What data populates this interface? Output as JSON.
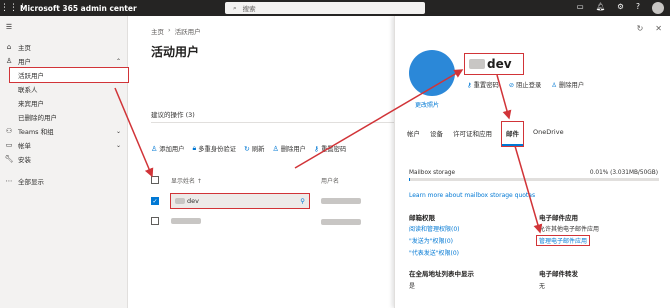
{
  "app": {
    "title": "Microsoft 365 admin center",
    "search_placeholder": "搜索"
  },
  "nav": {
    "home": "主页",
    "users": "用户",
    "active_users": "活跃用户",
    "contacts": "联系人",
    "guest_users": "来宾用户",
    "deleted_users": "已删除的用户",
    "teams_groups": "Teams 和组",
    "billing": "帐单",
    "setup": "安装",
    "show_all": "全部显示"
  },
  "main": {
    "breadcrumb": [
      "主页",
      "活跃用户"
    ],
    "title": "活动用户",
    "suggested": "建议的操作 (3)",
    "toolbar": [
      "添加用户",
      "多重身份验证",
      "刷新",
      "删除用户",
      "重置密码"
    ],
    "columns": [
      "显示姓名 ↑",
      "用户名"
    ],
    "rows": [
      {
        "name": "dev"
      }
    ]
  },
  "panel": {
    "user_name": "dev",
    "change_photo": "更改照片",
    "actions": [
      "重置密码",
      "阻止登录",
      "删除用户"
    ],
    "tabs": [
      "帐户",
      "设备",
      "许可证和应用",
      "邮件",
      "OneDrive"
    ],
    "storage_label": "Mailbox storage",
    "storage_value": "0.01% (3.031MB/50GB)",
    "storage_fraction": 0.0001,
    "storage_link": "Learn more about mailbox storage quotas",
    "mailbox_permissions_title": "邮箱权限",
    "perm_links": [
      "阅读和管理权限(0)",
      "\"发送为\"权限(0)",
      "\"代表发送\"权限(0)"
    ],
    "email_apps_title": "电子邮件应用",
    "email_apps_text": "允许其他电子邮件应用",
    "manage_apps_link": "管理电子邮件应用",
    "gal_title": "在全局地址列表中显示",
    "gal_value": "是",
    "forwarding_title": "电子邮件转发",
    "forwarding_value": "无"
  },
  "colors": {
    "accent": "#0078d4",
    "highlight": "#d13438",
    "topbar": "#252423"
  }
}
